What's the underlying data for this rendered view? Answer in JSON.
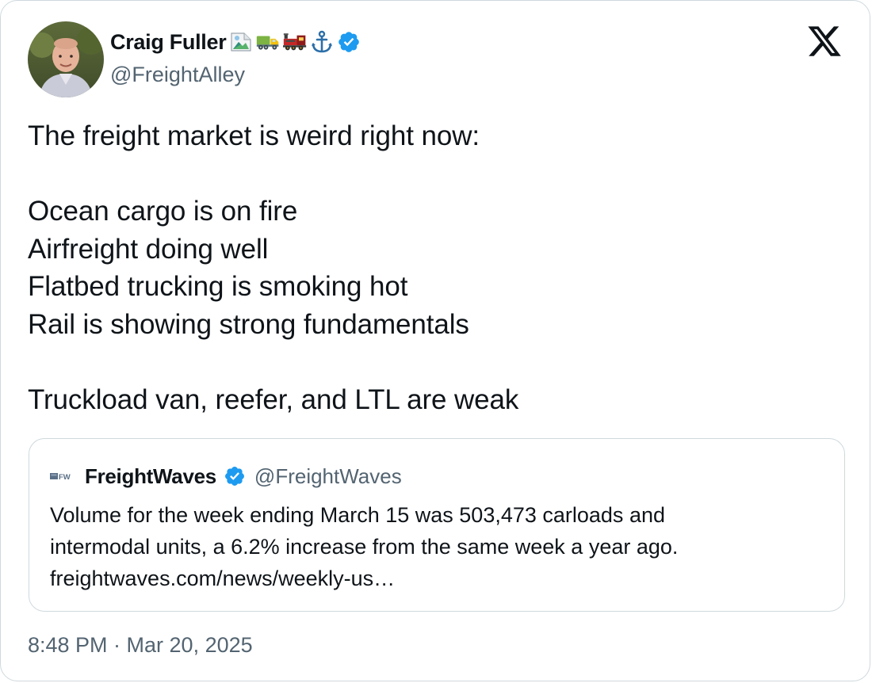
{
  "author": {
    "display_name": "Craig Fuller",
    "handle": "@FreightAlley",
    "emoji_icons": [
      "broken-image-icon",
      "truck-icon",
      "locomotive-icon",
      "anchor-icon"
    ],
    "verified": true
  },
  "tweet": {
    "lines": [
      "The freight market is weird right now:",
      "",
      "Ocean cargo is on fire",
      "Airfreight doing well",
      "Flatbed trucking is smoking hot",
      "Rail is showing strong fundamentals",
      "",
      "Truckload van, reefer, and LTL are weak"
    ]
  },
  "quoted_tweet": {
    "logo_text": "FW",
    "display_name": "FreightWaves",
    "handle": "@FreightWaves",
    "verified": true,
    "lines": [
      "Volume for the week ending March 15 was 503,473 carloads and",
      "intermodal units, a 6.2% increase from the same week a year ago.",
      "freightwaves.com/news/weekly-us…"
    ]
  },
  "timestamp": "8:48 PM · Mar 20, 2025",
  "colors": {
    "text": "#0f1419",
    "secondary_text": "#536471",
    "border": "#cfd9de",
    "verified_blue": "#1d9bf0"
  }
}
